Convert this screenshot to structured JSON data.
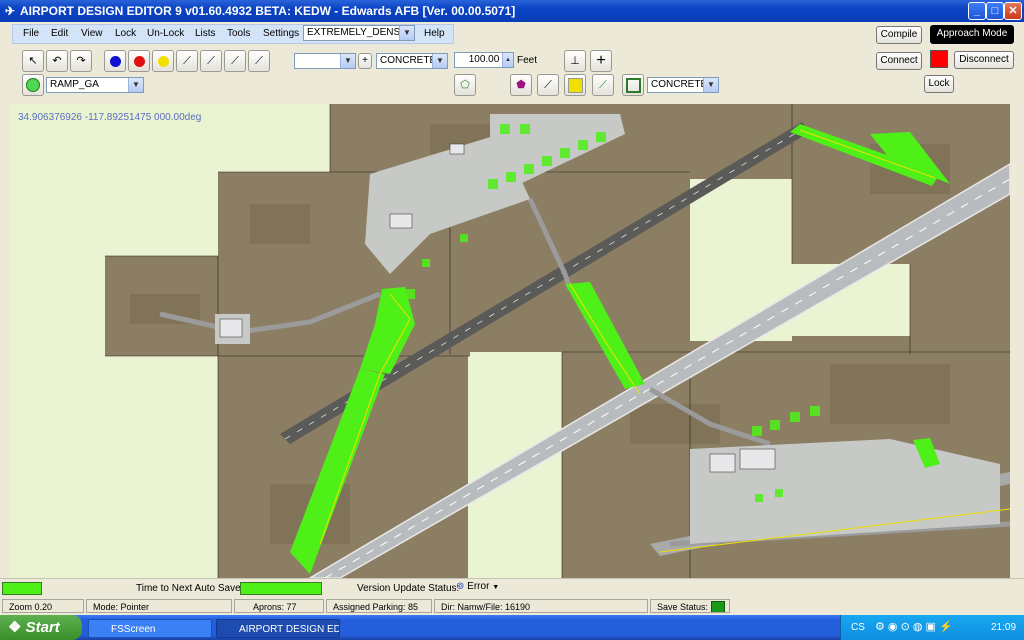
{
  "window": {
    "title": "AIRPORT DESIGN EDITOR 9  v01.60.4932 BETA: KEDW - Edwards AFB [Ver. 00.00.5071]",
    "buttons": {
      "minimize": "_",
      "maximize": "□",
      "close": "✕"
    }
  },
  "menu": {
    "items": [
      "File",
      "Edit",
      "View",
      "Lock",
      "Un-Lock",
      "Lists",
      "Tools",
      "Settings"
    ],
    "density_select": "EXTREMELY_DENSE",
    "help": "Help"
  },
  "toolbar": {
    "parking_type_select": "RAMP_GA",
    "surface_select_1": "CONCRETE",
    "surface_select_2": "CONCRETE",
    "width_value": "100.00",
    "width_unit": "Feet",
    "compile": "Compile",
    "approach_mode": "Approach Mode",
    "connect": "Connect",
    "disconnect": "Disconnect",
    "lock": "Lock",
    "indicator_color": "#ff0000"
  },
  "map": {
    "coordinate": "34.906376926    -117.89251475 000.00deg",
    "colors": {
      "grass": "#eaf3d2",
      "desert": "#8a7c62",
      "taxiway_edit": "#4ef018",
      "runway": "#b9bcbf"
    }
  },
  "autosave": {
    "label": "Time to Next Auto Save:",
    "version_label": "Version Update Status:",
    "version_status": "Error",
    "progress": 1.0
  },
  "status": {
    "zoom": "Zoom 0.20",
    "mode": "Mode: Pointer",
    "aprons": "Aprons: 77",
    "parking": "Assigned Parking: 85",
    "dir": "Dir: Namw/File: 16190",
    "save": "Save Status:"
  },
  "taskbar": {
    "start": "Start",
    "tasks": [
      "FSScreen",
      "AIRPORT DESIGN ED..."
    ],
    "lang": "CS",
    "clock": "21:09"
  }
}
